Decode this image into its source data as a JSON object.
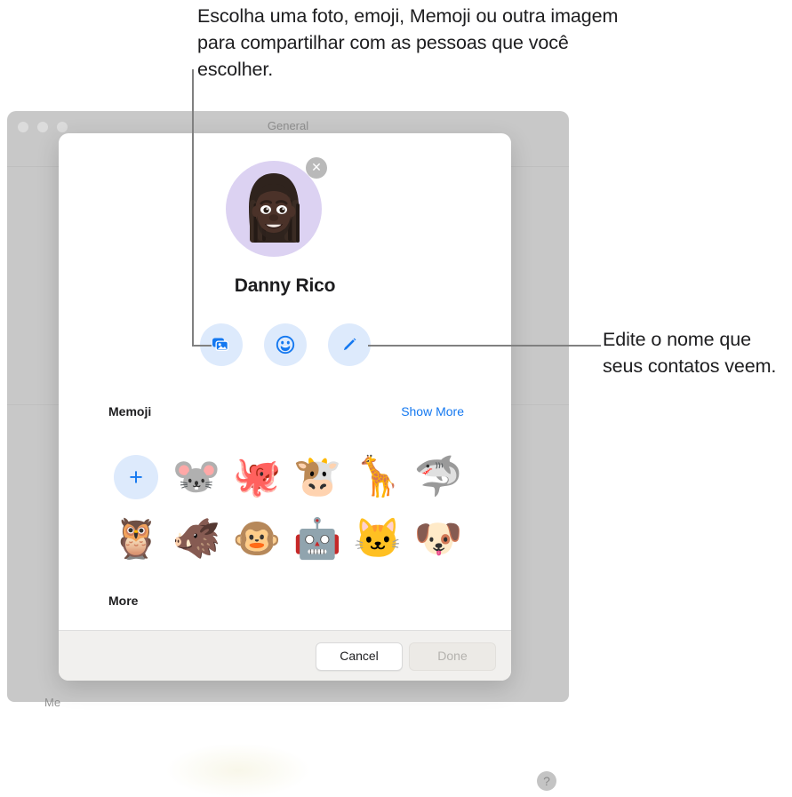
{
  "callouts": {
    "top": "Escolha uma foto, emoji, Memoji ou outra imagem para compartilhar com as pessoas que você escolher.",
    "right": "Edite o nome que seus contatos veem."
  },
  "background_window": {
    "title": "General",
    "partial_label": "Me",
    "help_label": "?",
    "traffic_lights": [
      "close",
      "minimize",
      "maximize"
    ]
  },
  "dialog": {
    "avatar": {
      "icon": "memoji-avatar",
      "background_color": "#dcd2f2",
      "close_label": "✕"
    },
    "profile_name": "Danny Rico",
    "actions": [
      {
        "name": "photos-button",
        "icon": "photos-icon"
      },
      {
        "name": "emoji-button",
        "icon": "smiley-icon"
      },
      {
        "name": "edit-button",
        "icon": "pencil-icon"
      }
    ],
    "memoji_section": {
      "title": "Memoji",
      "show_more": "Show More",
      "add_label": "+",
      "items": [
        {
          "name": "memoji-mouse",
          "glyph": "🐭"
        },
        {
          "name": "memoji-octopus",
          "glyph": "🐙"
        },
        {
          "name": "memoji-cow",
          "glyph": "🐮"
        },
        {
          "name": "memoji-giraffe",
          "glyph": "🦒"
        },
        {
          "name": "memoji-shark",
          "glyph": "🦈"
        },
        {
          "name": "memoji-owl",
          "glyph": "🦉"
        },
        {
          "name": "memoji-boar",
          "glyph": "🐗"
        },
        {
          "name": "memoji-monkey",
          "glyph": "🐵"
        },
        {
          "name": "memoji-robot",
          "glyph": "🤖"
        },
        {
          "name": "memoji-cat",
          "glyph": "🐱"
        },
        {
          "name": "memoji-dog",
          "glyph": "🐶"
        }
      ]
    },
    "more_section": {
      "title": "More"
    },
    "footer": {
      "cancel_label": "Cancel",
      "done_label": "Done",
      "done_disabled": true
    }
  },
  "colors": {
    "accent_blue": "#1478f0",
    "action_button_bg": "#ddeafc",
    "window_chrome": "#c8c8c8",
    "avatar_bg": "#dcd2f2"
  }
}
